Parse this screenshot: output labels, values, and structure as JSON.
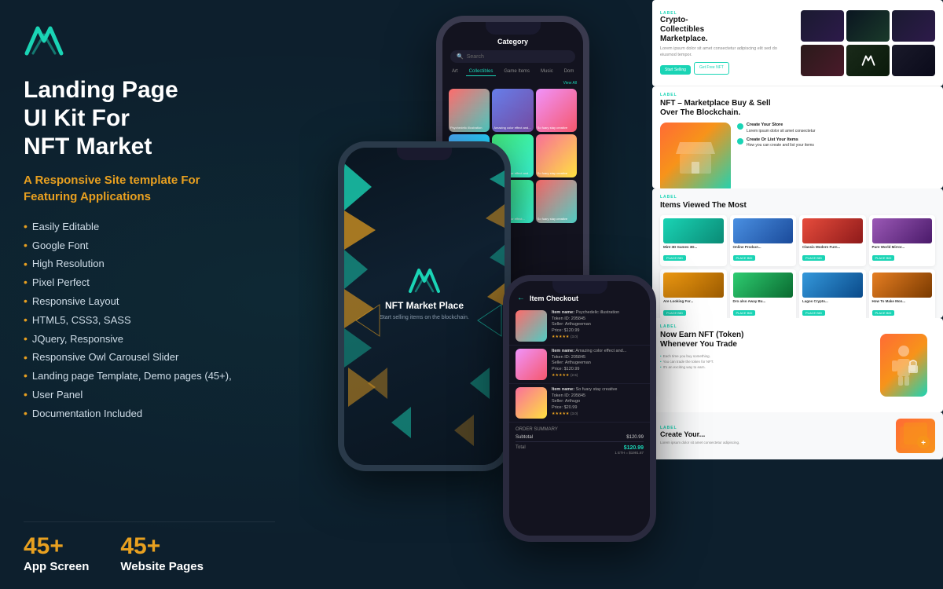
{
  "brand": {
    "logo_alt": "M Logo"
  },
  "left": {
    "title": "Landing Page\nUI Kit For\nNFT Market",
    "subtitle": "A Responsive Site template For\nFeaturing Applications",
    "features": [
      "Easily Editable",
      "Google Font",
      "High Resolution",
      "Pixel Perfect",
      "Responsive Layout",
      "HTML5, CSS3, SASS",
      "JQuery,  Responsive",
      "Responsive Owl Carousel Slider",
      "Landing page Template, Demo pages (45+),",
      "User Panel",
      "Documentation Included"
    ]
  },
  "stats": [
    {
      "number": "45+",
      "label": "App Screen"
    },
    {
      "number": "45+",
      "label": "Website Pages"
    }
  ],
  "phone1": {
    "header": "Category",
    "search_placeholder": "Search",
    "tabs": [
      "Art",
      "Collectibles",
      "Game Items",
      "Music",
      "Dom"
    ],
    "active_tab": "Collectibles",
    "view_all": "View All",
    "cards": [
      {
        "label": "Psychedelic\nillustration"
      },
      {
        "label": "Amazing color\neffect and..."
      },
      {
        "label": "So fuary\nstay creative"
      },
      {
        "label": "Psychedelic\nillustration"
      },
      {
        "label": "Amazing color\neffect and..."
      },
      {
        "label": "So fuary\nstay creative"
      }
    ]
  },
  "phone2": {
    "title": "NFT Market Place",
    "subtitle": "Start selling items on the blockchain."
  },
  "phone3": {
    "header": "Item Checkout",
    "items": [
      {
        "name": "Item name: Psychedelic illustration",
        "token": "Token ID: 205845",
        "seller": "Seller: Arthugeeman",
        "price": "Price: $120.99",
        "rating": "★★★★★ (3.0)"
      },
      {
        "name": "Item name: Amazing color effect and...",
        "token": "Token ID: 205845",
        "seller": "Seller: Arthugeeman",
        "price": "Price: $120.99",
        "rating": "★★★★★ (2.5)"
      },
      {
        "name": "Item name: So fuary stay creative",
        "token": "Token ID: 205845",
        "seller": "Seller: Arthugo",
        "price": "Price: $20.99",
        "rating": "★★★★★ (3.0)"
      }
    ],
    "order_summary_label": "Order Summary",
    "subtotal_label": "Subtotal",
    "subtotal_value": "$120.99",
    "total_label": "Total",
    "total_usd": "$120.99",
    "total_eth": "1 ETH = $1991.87"
  },
  "website": {
    "hero": {
      "label": "Label",
      "title": "Crypto-\nCollectibles\nMarketplace.",
      "description": "Lorem ipsum dolor sit amet consectetur adipiscing elit sed do eiusmod tempor.",
      "cta1": "Start Selling",
      "cta2": "Get Free NFT"
    },
    "market": {
      "label": "Label",
      "title": "NFT – Marketplace Buy & Sell\nOver The Blockchain.",
      "steps": [
        {
          "title": "Create Your Store",
          "desc": "Lorem ipsum dolor sit amet consectetur"
        },
        {
          "title": "Create Or List Your Items",
          "desc": "How you can create and list your items"
        }
      ]
    },
    "items_section": {
      "label": "Label",
      "title": "Items Viewed The Most",
      "items": [
        {
          "name": "Mint 3D Games 3D...",
          "price": "PLACE BID"
        },
        {
          "name": "Online Product...",
          "price": "PLACE BID"
        },
        {
          "name": "Classic Modern Furn...",
          "price": "PLACE BID"
        },
        {
          "name": "Pure World Mirror...",
          "price": "PLACE BID"
        },
        {
          "name": "Are Looking For...",
          "price": "PLACE BID"
        },
        {
          "name": "Dro also Away Bu...",
          "price": "PLACE BID"
        },
        {
          "name": "Lagos Crypto...",
          "price": "PLACE BID"
        },
        {
          "name": "How To Make Mon...",
          "price": "PLACE BID"
        }
      ]
    },
    "earn": {
      "label": "Label",
      "title": "Now Earn NFT (Token)\nWhenever You Trade",
      "points": [
        "Each time you buy something.",
        "You can trade the token for NFT.",
        "It's an exciting way to earn."
      ]
    },
    "create": {
      "label": "Label",
      "title": "Create Your..."
    }
  },
  "colors": {
    "accent": "#1ad4b5",
    "orange": "#e8a020",
    "bg_dark": "#0d1f2d",
    "white": "#ffffff"
  }
}
